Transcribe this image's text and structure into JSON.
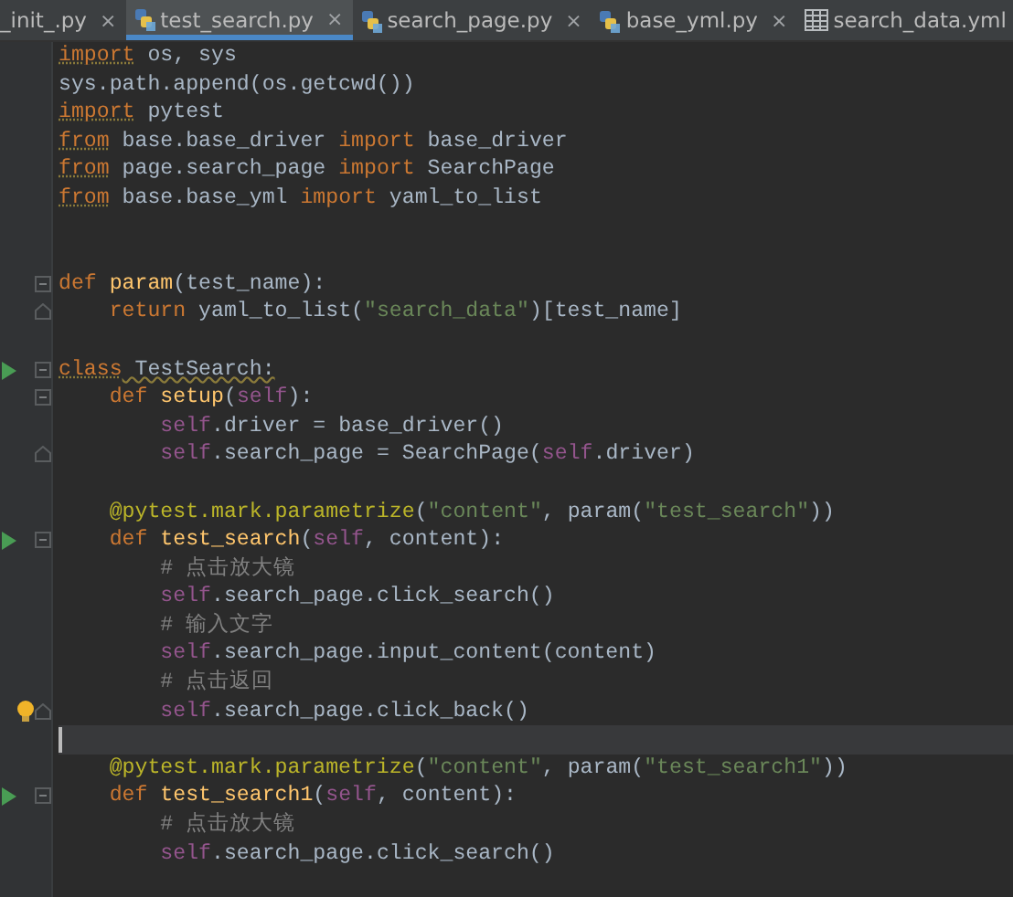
{
  "tabs": [
    {
      "label": "_init_.py",
      "kind": "python",
      "selected": false
    },
    {
      "label": "test_search.py",
      "kind": "python",
      "selected": true
    },
    {
      "label": "search_page.py",
      "kind": "python",
      "selected": false
    },
    {
      "label": "base_yml.py",
      "kind": "python",
      "selected": false
    },
    {
      "label": "search_data.yml",
      "kind": "yaml",
      "selected": false
    }
  ],
  "tab_close": "×",
  "lines": [
    {
      "tokens": [
        {
          "kind": "keyword",
          "text": "import",
          "warning": true
        },
        {
          "kind": "plain",
          "text": " os, sys"
        }
      ]
    },
    {
      "tokens": [
        {
          "kind": "plain",
          "text": "sys.path.append(os.getcwd())"
        }
      ]
    },
    {
      "tokens": [
        {
          "kind": "keyword",
          "text": "import",
          "warning": true
        },
        {
          "kind": "plain",
          "text": " pytest"
        }
      ]
    },
    {
      "tokens": [
        {
          "kind": "keyword",
          "text": "from",
          "warning": true
        },
        {
          "kind": "plain",
          "text": " base.base_driver "
        },
        {
          "kind": "keyword",
          "text": "import"
        },
        {
          "kind": "plain",
          "text": " base_driver"
        }
      ]
    },
    {
      "tokens": [
        {
          "kind": "keyword",
          "text": "from",
          "warning": true
        },
        {
          "kind": "plain",
          "text": " page.search_page "
        },
        {
          "kind": "keyword",
          "text": "import"
        },
        {
          "kind": "plain",
          "text": " SearchPage"
        }
      ]
    },
    {
      "tokens": [
        {
          "kind": "keyword",
          "text": "from",
          "warning": true
        },
        {
          "kind": "plain",
          "text": " base.base_yml "
        },
        {
          "kind": "keyword",
          "text": "import"
        },
        {
          "kind": "plain",
          "text": " yaml_to_list"
        }
      ]
    },
    {
      "blank": true
    },
    {
      "blank": true
    },
    {
      "fold_start": true,
      "tokens": [
        {
          "kind": "keyword",
          "text": "def "
        },
        {
          "kind": "function",
          "text": "param"
        },
        {
          "kind": "plain",
          "text": "(test_name):"
        }
      ]
    },
    {
      "fold_end": true,
      "tokens": [
        {
          "kind": "keyword",
          "text": "    return"
        },
        {
          "kind": "plain",
          "text": " yaml_to_list("
        },
        {
          "kind": "string",
          "text": "\"search_data\""
        },
        {
          "kind": "plain",
          "text": ")[test_name]"
        }
      ]
    },
    {
      "blank": true
    },
    {
      "run": true,
      "fold_start": true,
      "tokens": [
        {
          "kind": "keyword",
          "text": "class",
          "warning": true
        },
        {
          "kind": "plain",
          "text": " TestSearch:",
          "warning": true
        }
      ]
    },
    {
      "fold_start": true,
      "tokens": [
        {
          "kind": "keyword",
          "text": "    def "
        },
        {
          "kind": "function",
          "text": "setup"
        },
        {
          "kind": "plain",
          "text": "("
        },
        {
          "kind": "self",
          "text": "self"
        },
        {
          "kind": "plain",
          "text": "):"
        }
      ]
    },
    {
      "tokens": [
        {
          "kind": "self",
          "text": "        self"
        },
        {
          "kind": "plain",
          "text": ".driver = base_driver()"
        }
      ]
    },
    {
      "fold_end": true,
      "tokens": [
        {
          "kind": "self",
          "text": "        self"
        },
        {
          "kind": "plain",
          "text": ".search_page = SearchPage("
        },
        {
          "kind": "self",
          "text": "self"
        },
        {
          "kind": "plain",
          "text": ".driver)"
        }
      ]
    },
    {
      "blank": true
    },
    {
      "tokens": [
        {
          "kind": "decorator",
          "text": "    @pytest.mark.parametrize"
        },
        {
          "kind": "plain",
          "text": "("
        },
        {
          "kind": "string",
          "text": "\"content\""
        },
        {
          "kind": "plain",
          "text": ", param("
        },
        {
          "kind": "string",
          "text": "\"test_search\""
        },
        {
          "kind": "plain",
          "text": "))"
        }
      ]
    },
    {
      "run": true,
      "fold_start": true,
      "tokens": [
        {
          "kind": "keyword",
          "text": "    def "
        },
        {
          "kind": "function",
          "text": "test_search"
        },
        {
          "kind": "plain",
          "text": "("
        },
        {
          "kind": "self",
          "text": "self"
        },
        {
          "kind": "plain",
          "text": ", content):"
        }
      ]
    },
    {
      "tokens": [
        {
          "kind": "comment",
          "text": "        # 点击放大镜"
        }
      ]
    },
    {
      "tokens": [
        {
          "kind": "self",
          "text": "        self"
        },
        {
          "kind": "plain",
          "text": ".search_page.click_search()"
        }
      ]
    },
    {
      "tokens": [
        {
          "kind": "comment",
          "text": "        # 输入文字"
        }
      ]
    },
    {
      "tokens": [
        {
          "kind": "self",
          "text": "        self"
        },
        {
          "kind": "plain",
          "text": ".search_page.input_content(content)"
        }
      ]
    },
    {
      "tokens": [
        {
          "kind": "comment",
          "text": "        # 点击返回"
        }
      ]
    },
    {
      "fold_end": true,
      "bulb": true,
      "tokens": [
        {
          "kind": "self",
          "text": "        self"
        },
        {
          "kind": "plain",
          "text": ".search_page.click_back()"
        }
      ]
    },
    {
      "current": true
    },
    {
      "tokens": [
        {
          "kind": "decorator",
          "text": "    @pytest.mark.parametrize"
        },
        {
          "kind": "plain",
          "text": "("
        },
        {
          "kind": "string",
          "text": "\"content\""
        },
        {
          "kind": "plain",
          "text": ", param("
        },
        {
          "kind": "string",
          "text": "\"test_search1\""
        },
        {
          "kind": "plain",
          "text": "))"
        }
      ]
    },
    {
      "run": true,
      "fold_start": true,
      "tokens": [
        {
          "kind": "keyword",
          "text": "    def "
        },
        {
          "kind": "function",
          "text": "test_search1"
        },
        {
          "kind": "plain",
          "text": "("
        },
        {
          "kind": "self",
          "text": "self"
        },
        {
          "kind": "plain",
          "text": ", content):"
        }
      ]
    },
    {
      "tokens": [
        {
          "kind": "comment",
          "text": "        # 点击放大镜"
        }
      ]
    },
    {
      "tokens": [
        {
          "kind": "self",
          "text": "        self"
        },
        {
          "kind": "plain",
          "text": ".search_page.click_search()"
        }
      ]
    }
  ]
}
